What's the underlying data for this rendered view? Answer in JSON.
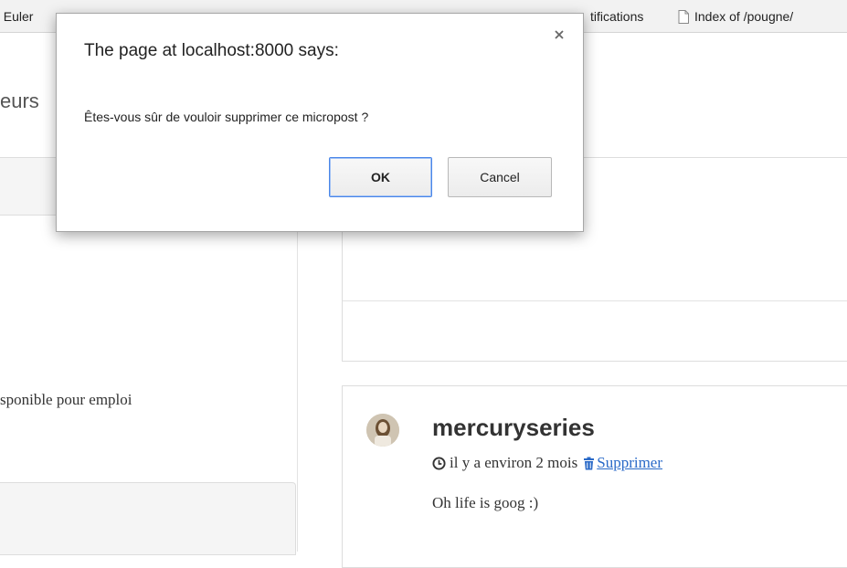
{
  "bookmarks_bar": {
    "items": [
      {
        "label": "t Euler"
      },
      {
        "label": "tifications"
      },
      {
        "label": "Index of /pougne/"
      }
    ],
    "icons": {
      "page": "page-icon"
    }
  },
  "page": {
    "left_title": "eurs",
    "left_text": "sponible pour emploi",
    "post": {
      "username": "mercuryseries",
      "time": "il y a environ 2 mois",
      "delete_label": " Supprimer",
      "content": "Oh life is goog :)"
    }
  },
  "dialog": {
    "title": "The page at localhost:8000 says:",
    "message": "Êtes-vous sûr de vouloir supprimer ce micropost ?",
    "ok_label": "OK",
    "cancel_label": "Cancel"
  },
  "colors": {
    "link": "#2a6ac8",
    "focus_border": "#4a86e8"
  }
}
